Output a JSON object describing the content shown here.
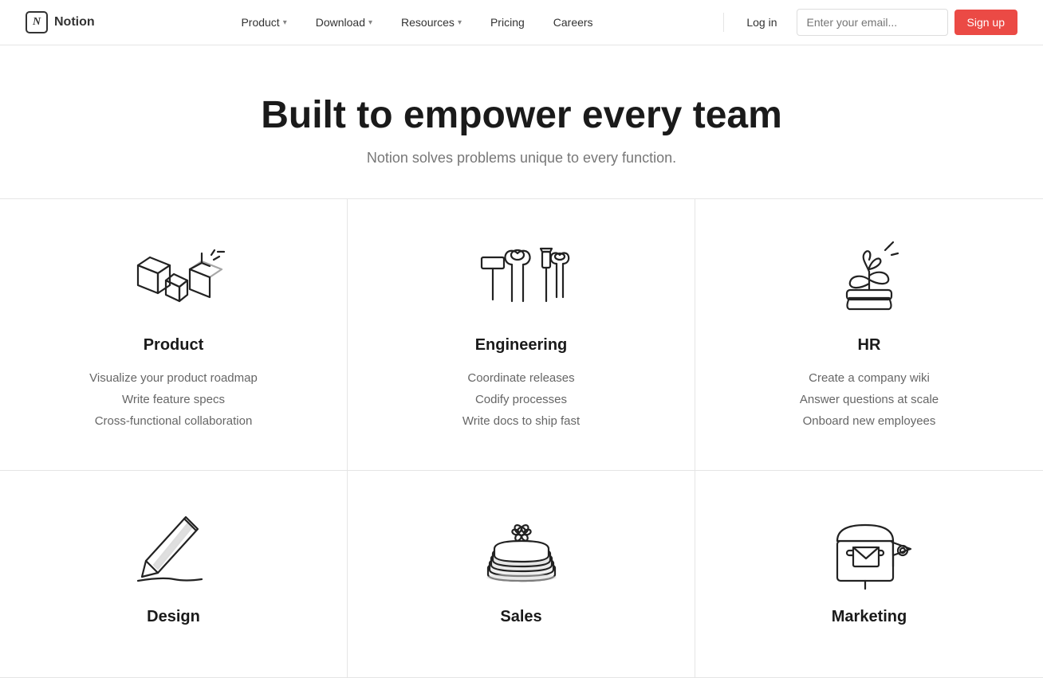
{
  "nav": {
    "logo_text": "Notion",
    "links": [
      {
        "label": "Product",
        "has_dropdown": true
      },
      {
        "label": "Download",
        "has_dropdown": true
      },
      {
        "label": "Resources",
        "has_dropdown": true
      },
      {
        "label": "Pricing",
        "has_dropdown": false
      },
      {
        "label": "Careers",
        "has_dropdown": false
      }
    ],
    "login_label": "Log in",
    "email_placeholder": "Enter your email...",
    "signup_label": "Sign up"
  },
  "hero": {
    "title": "Built to empower every team",
    "subtitle": "Notion solves problems unique to every function."
  },
  "cards": [
    {
      "id": "product",
      "title": "Product",
      "features": [
        "Visualize your product roadmap",
        "Write feature specs",
        "Cross-functional collaboration"
      ],
      "icon": "boxes"
    },
    {
      "id": "engineering",
      "title": "Engineering",
      "features": [
        "Coordinate releases",
        "Codify processes",
        "Write docs to ship fast"
      ],
      "icon": "tools"
    },
    {
      "id": "hr",
      "title": "HR",
      "features": [
        "Create a company wiki",
        "Answer questions at scale",
        "Onboard new employees"
      ],
      "icon": "plant"
    },
    {
      "id": "design",
      "title": "Design",
      "features": [
        "",
        "",
        ""
      ],
      "icon": "pen"
    },
    {
      "id": "sales",
      "title": "Sales",
      "features": [
        "",
        "",
        ""
      ],
      "icon": "books"
    },
    {
      "id": "marketing",
      "title": "Marketing",
      "features": [
        "",
        "",
        ""
      ],
      "icon": "mailbox"
    }
  ],
  "colors": {
    "accent": "#eb4a45",
    "text_primary": "#1a1a1a",
    "text_secondary": "#666",
    "border": "#e5e5e5"
  }
}
